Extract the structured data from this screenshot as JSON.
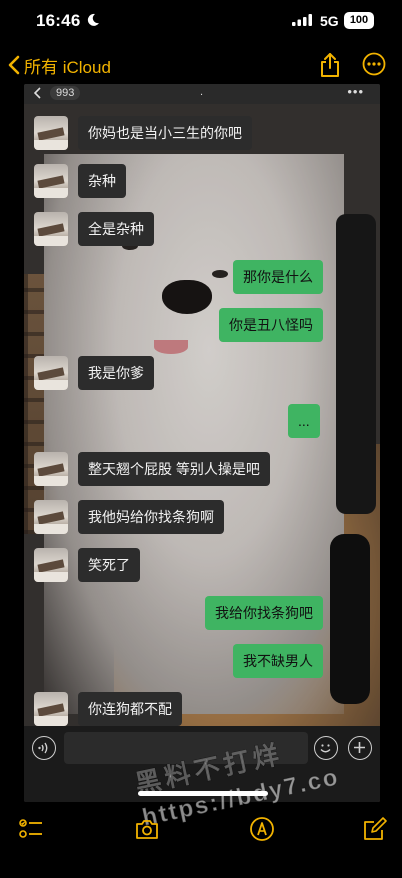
{
  "status_bar": {
    "time": "16:46",
    "network": "5G",
    "battery": "100"
  },
  "nav": {
    "back_label": "所有 iCloud"
  },
  "chat": {
    "header": {
      "unread_count": "993",
      "title": "."
    },
    "messages": [
      {
        "side": "in",
        "text": "你妈也是当小三生的你吧"
      },
      {
        "side": "in",
        "text": "杂种"
      },
      {
        "side": "in",
        "text": "全是杂种"
      },
      {
        "side": "out",
        "text": "那你是什么"
      },
      {
        "side": "out",
        "text": "你是丑八怪吗"
      },
      {
        "side": "in",
        "text": "我是你爹"
      },
      {
        "side": "out",
        "text": "..."
      },
      {
        "side": "in",
        "text": "整天翘个屁股 等别人操是吧"
      },
      {
        "side": "in",
        "text": "我他妈给你找条狗啊"
      },
      {
        "side": "in",
        "text": "笑死了"
      },
      {
        "side": "out",
        "text": "我给你找条狗吧"
      },
      {
        "side": "out",
        "text": "我不缺男人"
      },
      {
        "side": "in",
        "text": "你连狗都不配"
      }
    ]
  },
  "watermark": {
    "line1": "黑料不打烊",
    "line2": "https://bdy7.co"
  },
  "colors": {
    "accent": "#f2b300",
    "outgoing_bubble": "#3fb462",
    "incoming_bubble": "#2c2c2c"
  },
  "icons": [
    "moon-icon",
    "signal-icon",
    "battery-icon",
    "chevron-left-icon",
    "share-icon",
    "more-icon",
    "voice-icon",
    "emoji-icon",
    "plus-icon",
    "checklist-icon",
    "camera-icon",
    "markup-icon",
    "compose-icon"
  ]
}
